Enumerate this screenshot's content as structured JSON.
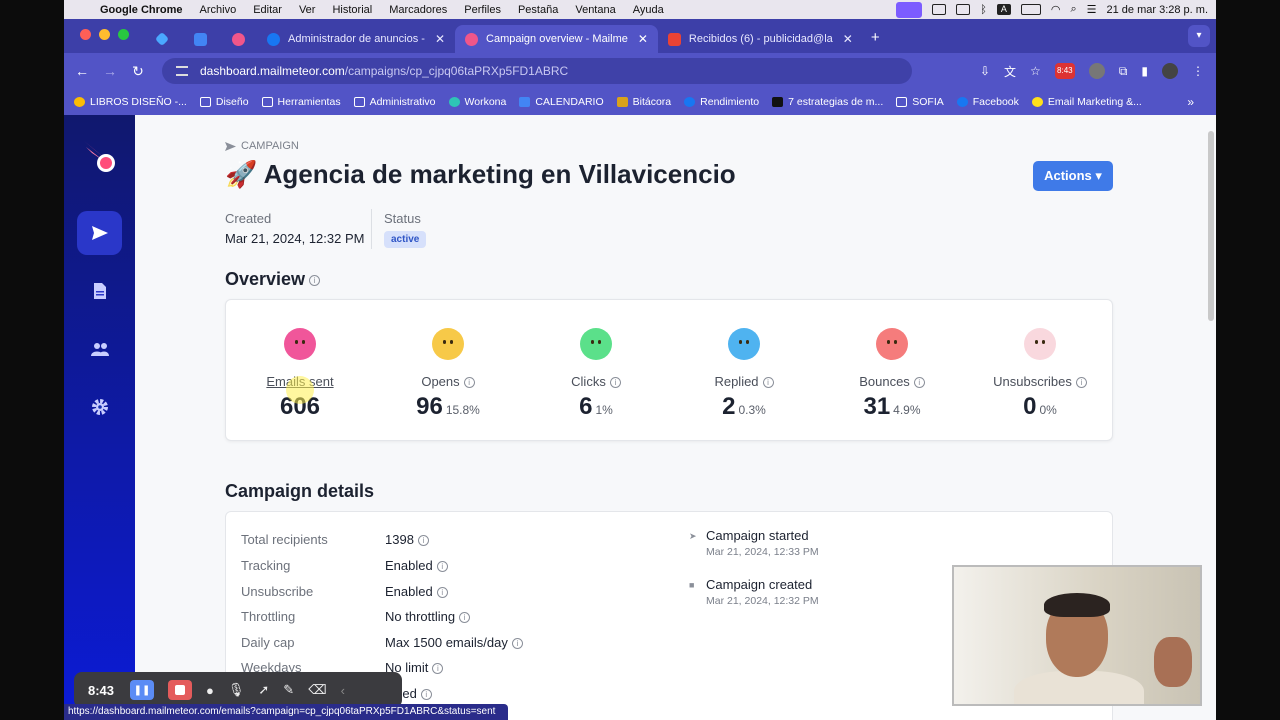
{
  "menubar": {
    "app": "Google Chrome",
    "items": [
      "Archivo",
      "Editar",
      "Ver",
      "Historial",
      "Marcadores",
      "Perfiles",
      "Pestaña",
      "Ventana",
      "Ayuda"
    ],
    "clock": "21 de mar 3:28 p. m."
  },
  "tabs": [
    {
      "label": "Administrador de anuncios -",
      "fav": "#1877f2",
      "active": false
    },
    {
      "label": "Campaign overview - Mailme",
      "fav": "#f0568a",
      "active": true
    },
    {
      "label": "Recibidos (6) - publicidad@la",
      "fav": "#ea4335",
      "active": false
    }
  ],
  "address": {
    "host": "dashboard.mailmeteor.com",
    "path": "/campaigns/cp_cjpq06taPRXp5FD1ABRC"
  },
  "ext_badge": "8:43",
  "bookmarks": [
    "LIBROS DISEÑO -...",
    "Diseño",
    "Herramientas",
    "Administrativo",
    "Workona",
    "CALENDARIO",
    "Bitácora",
    "Rendimiento",
    "7 estrategias de m...",
    "SOFIA",
    "Facebook",
    "Email Marketing &..."
  ],
  "bookmarks_more": "»",
  "crumb": "CAMPAIGN",
  "title": "🚀 Agencia de marketing en Villavicencio",
  "actions_label": "Actions ▾",
  "meta": {
    "created_label": "Created",
    "created_value": "Mar 21, 2024, 12:32 PM",
    "status_label": "Status",
    "status_value": "active"
  },
  "overview_title": "Overview",
  "stats": [
    {
      "label": "Emails sent",
      "value": "606",
      "pct": "",
      "color": "#f0569a"
    },
    {
      "label": "Opens",
      "value": "96",
      "pct": "15.8%",
      "color": "#f7c948"
    },
    {
      "label": "Clicks",
      "value": "6",
      "pct": "1%",
      "color": "#5be08a"
    },
    {
      "label": "Replied",
      "value": "2",
      "pct": "0.3%",
      "color": "#4fb3f0"
    },
    {
      "label": "Bounces",
      "value": "31",
      "pct": "4.9%",
      "color": "#f57c7c"
    },
    {
      "label": "Unsubscribes",
      "value": "0",
      "pct": "0%",
      "color": "#f9d8de"
    }
  ],
  "details_title": "Campaign details",
  "details": [
    {
      "k": "Total recipients",
      "v": "1398"
    },
    {
      "k": "Tracking",
      "v": "Enabled"
    },
    {
      "k": "Unsubscribe",
      "v": "Enabled"
    },
    {
      "k": "Throttling",
      "v": "No throttling"
    },
    {
      "k": "Daily cap",
      "v": "Max 1500 emails/day"
    },
    {
      "k": "Weekdays",
      "v": "No limit"
    },
    {
      "k": "",
      "v": "abled"
    }
  ],
  "timeline": [
    {
      "title": "Campaign started",
      "date": "Mar 21, 2024, 12:33 PM",
      "icon": "send-icon"
    },
    {
      "title": "Campaign created",
      "date": "Mar 21, 2024, 12:32 PM",
      "icon": "save-icon"
    }
  ],
  "recorder": {
    "time": "8:43"
  },
  "status_url": "https://dashboard.mailmeteor.com/emails?campaign=cp_cjpq06taPRXp5FD1ABRC&status=sent"
}
